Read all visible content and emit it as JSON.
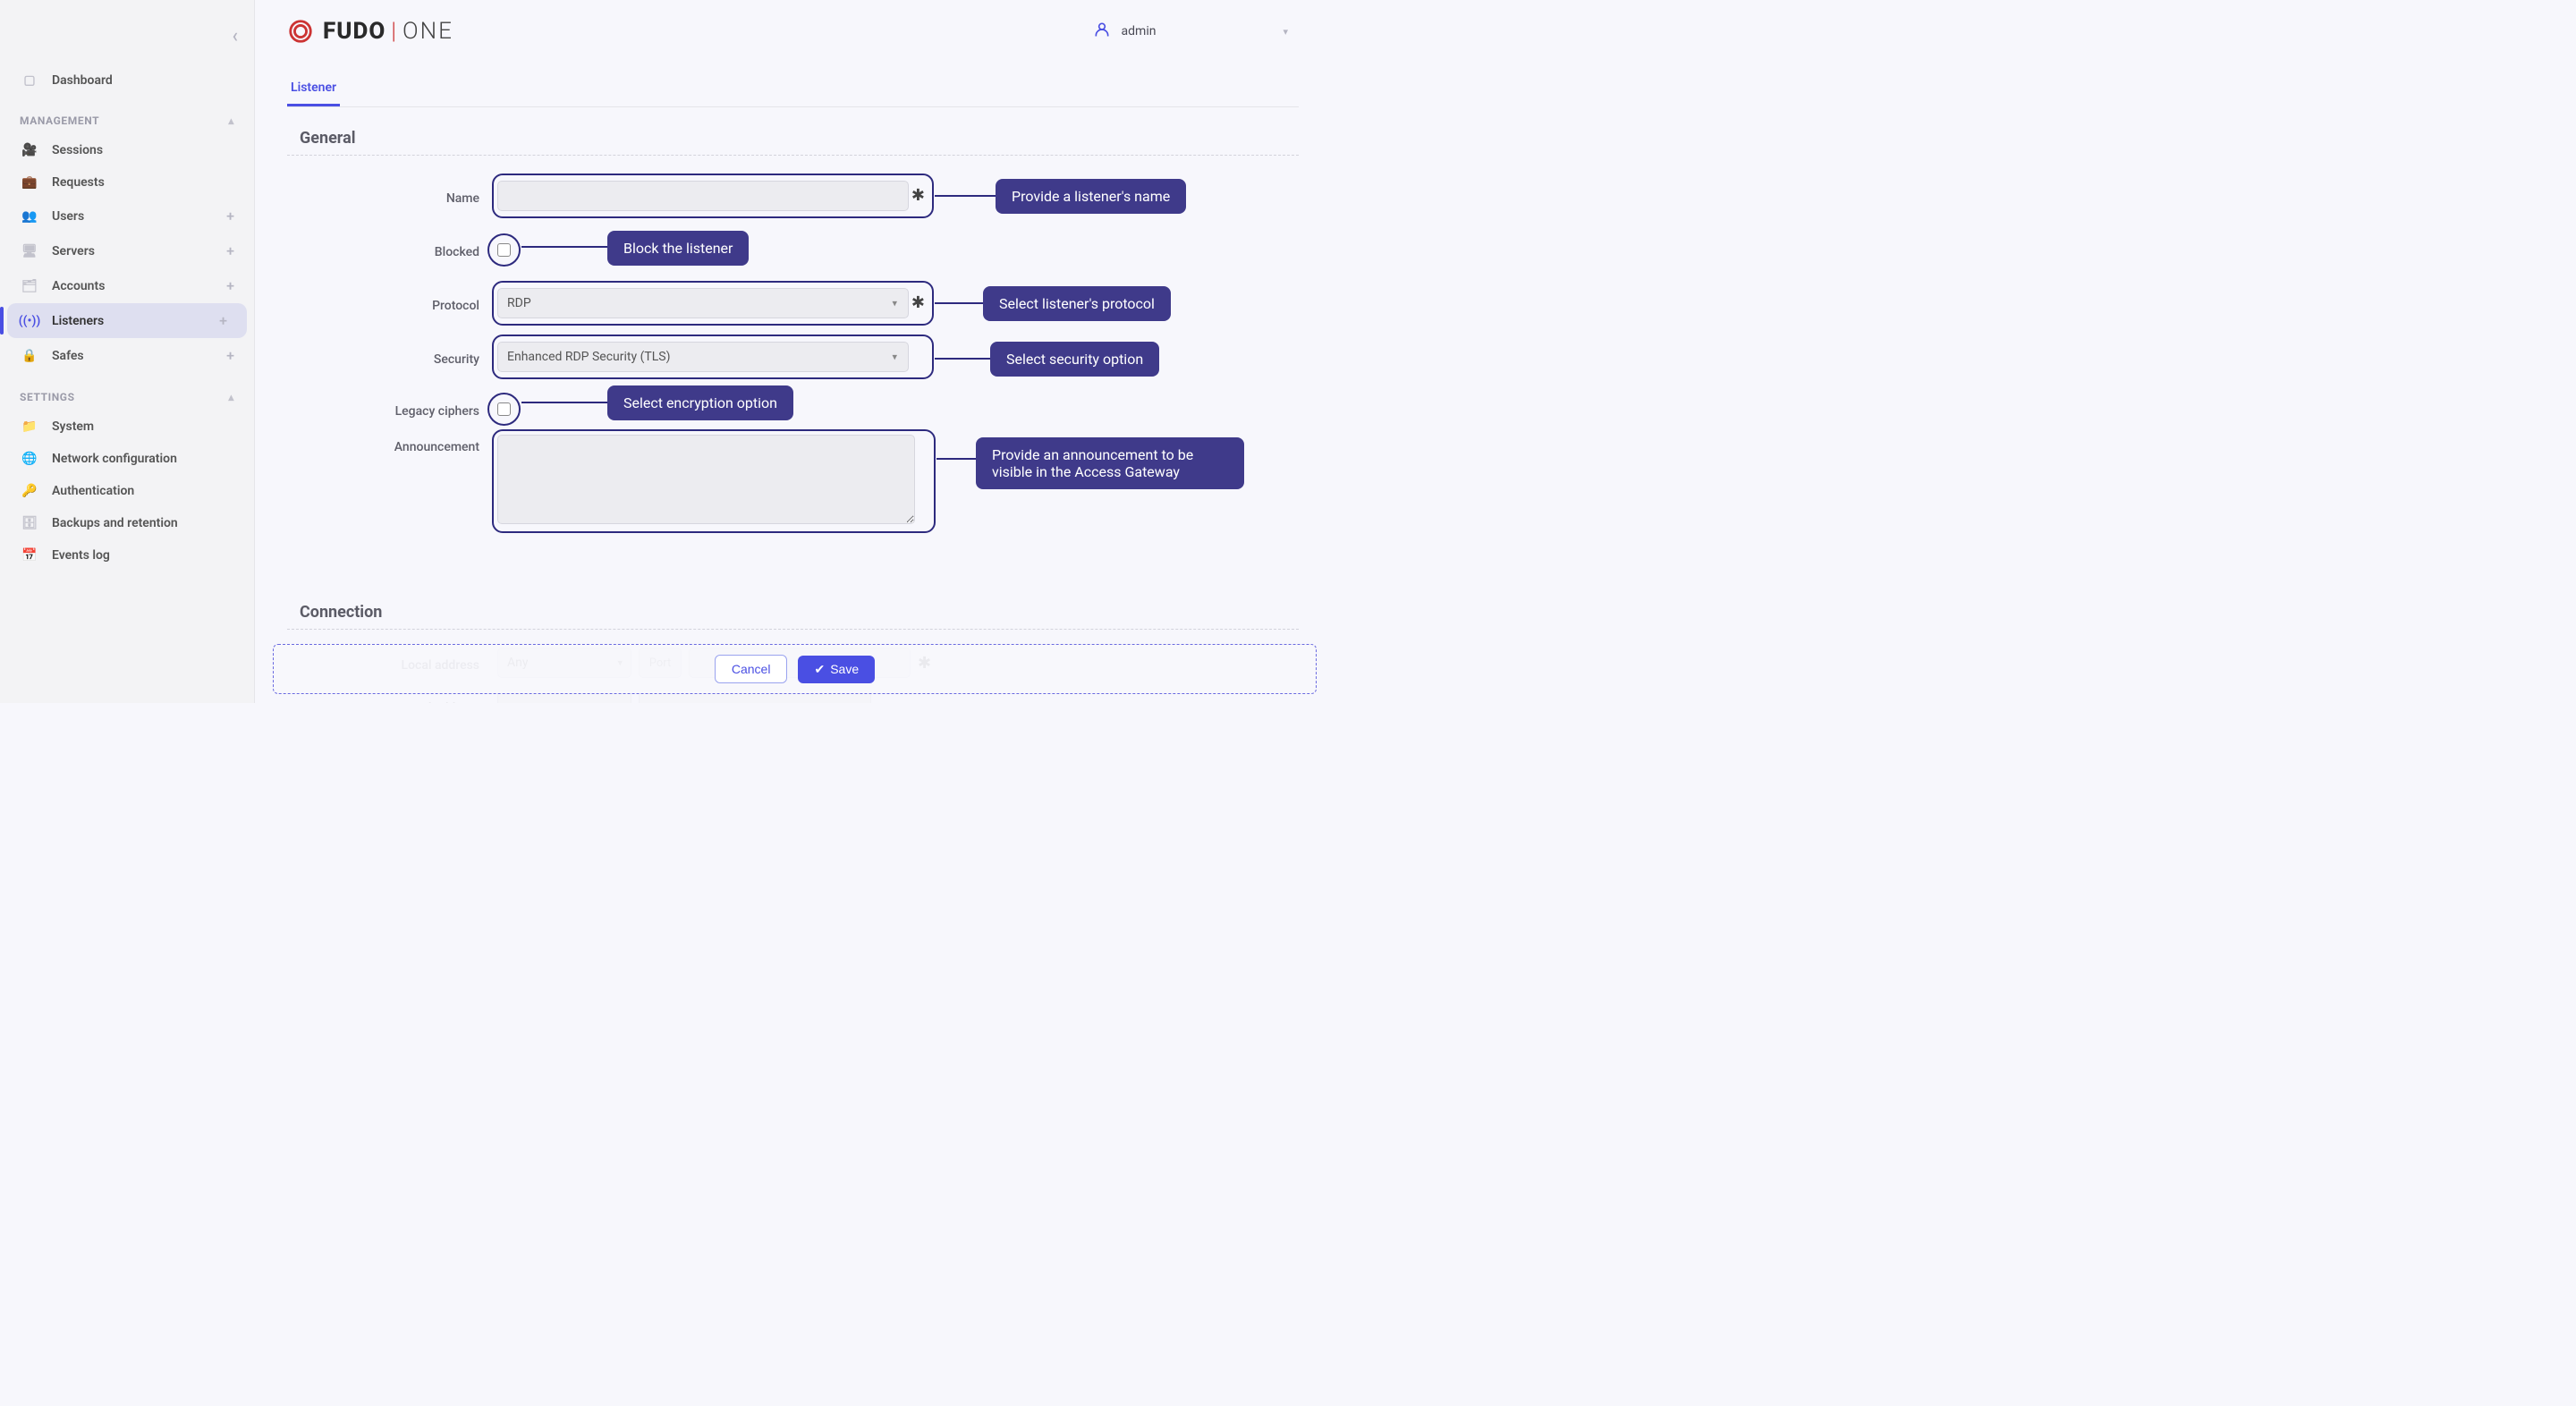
{
  "header": {
    "logo_main": "FUDO",
    "logo_sep": "|",
    "logo_suffix": "ONE",
    "user": "admin"
  },
  "sidebar": {
    "dashboard": "Dashboard",
    "group_management": "MANAGEMENT",
    "sessions": "Sessions",
    "requests": "Requests",
    "users": "Users",
    "servers": "Servers",
    "accounts": "Accounts",
    "listeners": "Listeners",
    "safes": "Safes",
    "group_settings": "SETTINGS",
    "system": "System",
    "network": "Network configuration",
    "auth": "Authentication",
    "backups": "Backups and retention",
    "events": "Events log"
  },
  "tabs": {
    "listener": "Listener"
  },
  "sections": {
    "general": "General",
    "connection": "Connection"
  },
  "form": {
    "name_label": "Name",
    "name_value": "",
    "blocked_label": "Blocked",
    "protocol_label": "Protocol",
    "protocol_value": "RDP",
    "security_label": "Security",
    "security_value": "Enhanced RDP Security (TLS)",
    "legacy_label": "Legacy ciphers",
    "announce_label": "Announcement",
    "announce_value": "",
    "local_addr_label": "Local address",
    "local_addr_value": "Any",
    "port_label": "Port"
  },
  "callouts": {
    "name": "Provide a listener's name",
    "blocked": "Block the listener",
    "protocol": "Select listener's protocol",
    "security": "Select security option",
    "legacy": "Select encryption option",
    "announce": "Provide an announcement to be visible in the Access Gateway"
  },
  "footer": {
    "cancel": "Cancel",
    "save": "Save"
  }
}
